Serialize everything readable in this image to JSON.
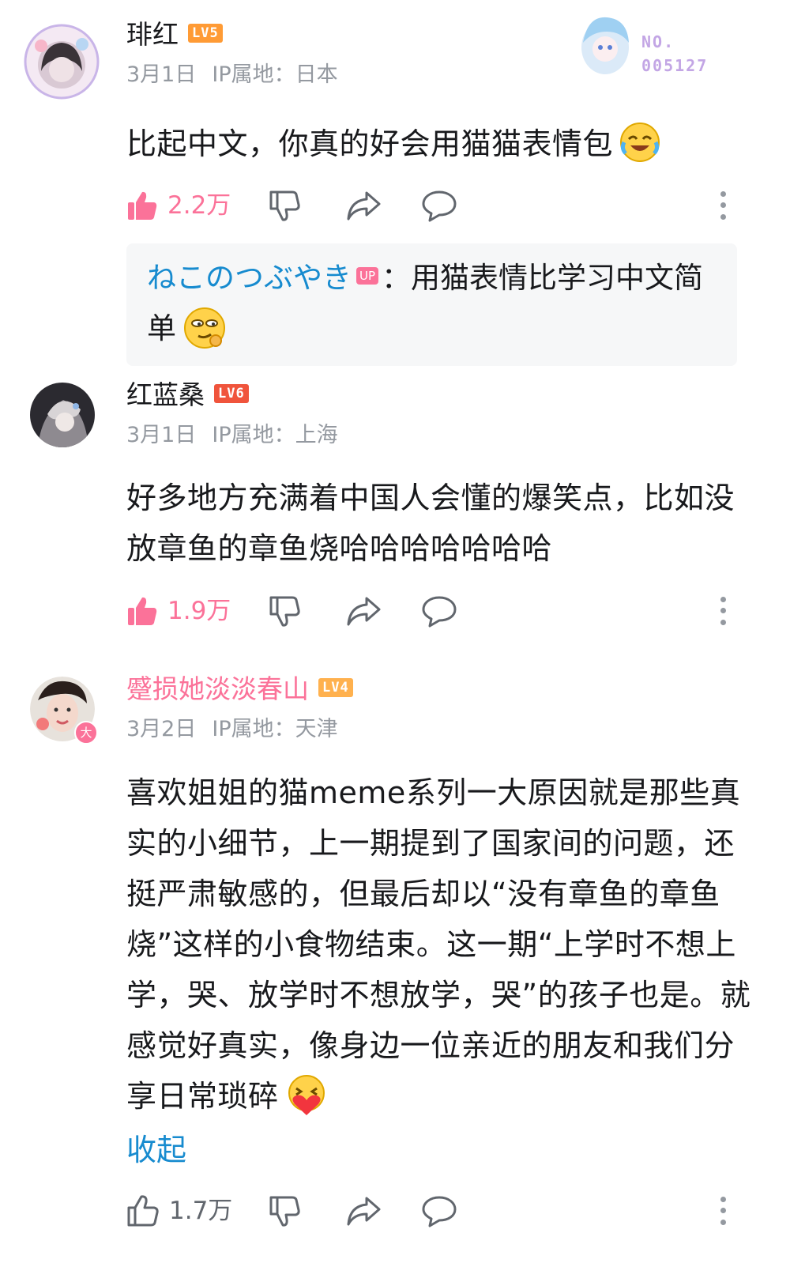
{
  "colors": {
    "accent": "#fb7299",
    "link": "#178bcf",
    "muted": "#9499a0",
    "lv5": "#ff9b35",
    "lv6": "#f0543c",
    "lv4": "#ffb14e"
  },
  "comments": [
    {
      "username": "琲红",
      "level": "LV5",
      "date": "3月1日",
      "ip": "IP属地：日本",
      "text": "比起中文，你真的好会用猫猫表情包",
      "emoji": "laughing-crying-emoji",
      "likes": "2.2万",
      "decoration_no": "NO.\n005127",
      "reply": {
        "name": "ねこのつぶやき",
        "badge": "UP",
        "text": "：用猫表情比学习中文简单",
        "emoji": "smirk-emoji"
      }
    },
    {
      "username": "红蓝桑",
      "level": "LV6",
      "date": "3月1日",
      "ip": "IP属地：上海",
      "text": "好多地方充满着中国人会懂的爆笑点，比如没放章鱼的章鱼烧哈哈哈哈哈哈哈",
      "likes": "1.9万"
    },
    {
      "username": "蹙损她淡淡春山",
      "level": "LV4",
      "date": "3月2日",
      "ip": "IP属地：天津",
      "text": "喜欢姐姐的猫meme系列一大原因就是那些真实的小细节，上一期提到了国家间的问题，还挺严肃敏感的，但最后却以“没有章鱼的章鱼烧”这样的小食物结束。这一期“上学时不想上学，哭、放学时不想放学，哭”的孩子也是。就感觉好真实，像身边一位亲近的朋友和我们分享日常琐碎",
      "emoji": "heart-hug-emoji",
      "likes": "1.7万",
      "collapse": "收起",
      "avatar_badge": "大"
    }
  ]
}
